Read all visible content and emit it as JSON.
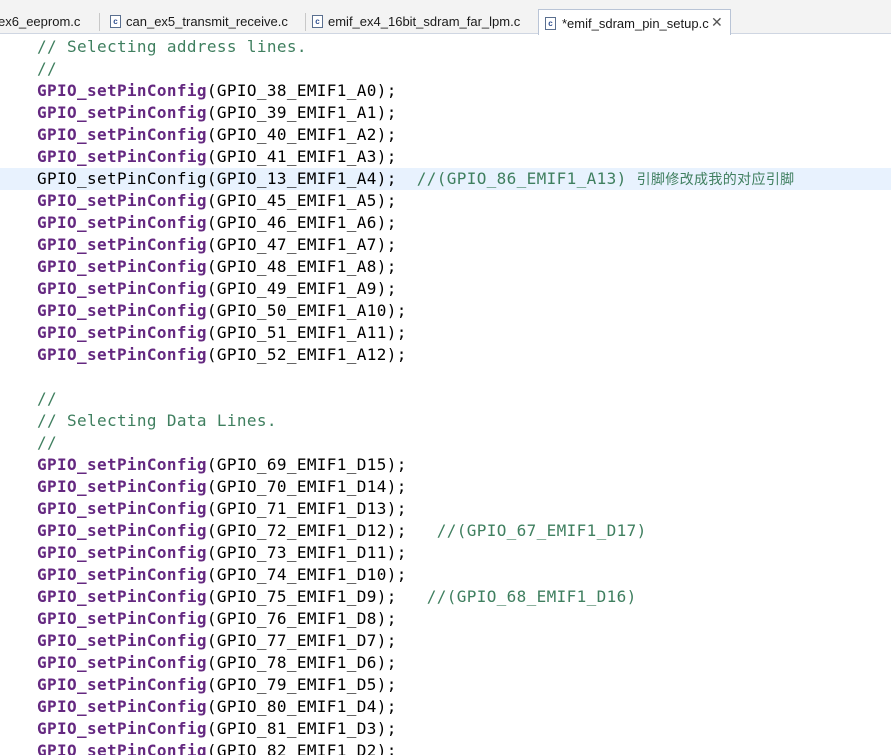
{
  "tabs": [
    {
      "label": "ex6_eeprom.c",
      "active": false,
      "icon": "c-file-icon"
    },
    {
      "label": "can_ex5_transmit_receive.c",
      "active": false,
      "icon": "c-file-icon"
    },
    {
      "label": "emif_ex4_16bit_sdram_far_lpm.c",
      "active": false,
      "icon": "c-file-icon"
    },
    {
      "label": "*emif_sdram_pin_setup.c",
      "active": true,
      "icon": "c-file-icon",
      "close": "✕"
    }
  ],
  "icon_glyph": "c",
  "highlighted_line": 6,
  "colors": {
    "function": "#642880",
    "comment": "#3f7f5f",
    "line_highlight": "#e8f2fe"
  },
  "code": [
    {
      "c": "// Selecting address lines."
    },
    {
      "c": "//"
    },
    {
      "f": "GPIO_setPinConfig",
      "a": "(GPIO_38_EMIF1_A0);"
    },
    {
      "f": "GPIO_setPinConfig",
      "a": "(GPIO_39_EMIF1_A1);"
    },
    {
      "f": "GPIO_setPinConfig",
      "a": "(GPIO_40_EMIF1_A2);"
    },
    {
      "f": "GPIO_setPinConfig",
      "a": "(GPIO_41_EMIF1_A3);"
    },
    {
      "p": "GPIO_setPinConfig(GPIO_13_EMIF1_A4);  ",
      "c": "//(GPIO_86_EMIF1_A13) ",
      "cn": "引脚修改成我的对应引脚"
    },
    {
      "f": "GPIO_setPinConfig",
      "a": "(GPIO_45_EMIF1_A5);"
    },
    {
      "f": "GPIO_setPinConfig",
      "a": "(GPIO_46_EMIF1_A6);"
    },
    {
      "f": "GPIO_setPinConfig",
      "a": "(GPIO_47_EMIF1_A7);"
    },
    {
      "f": "GPIO_setPinConfig",
      "a": "(GPIO_48_EMIF1_A8);"
    },
    {
      "f": "GPIO_setPinConfig",
      "a": "(GPIO_49_EMIF1_A9);"
    },
    {
      "f": "GPIO_setPinConfig",
      "a": "(GPIO_50_EMIF1_A10);"
    },
    {
      "f": "GPIO_setPinConfig",
      "a": "(GPIO_51_EMIF1_A11);"
    },
    {
      "f": "GPIO_setPinConfig",
      "a": "(GPIO_52_EMIF1_A12);"
    },
    {},
    {
      "c": "//"
    },
    {
      "c": "// Selecting Data Lines."
    },
    {
      "c": "//"
    },
    {
      "f": "GPIO_setPinConfig",
      "a": "(GPIO_69_EMIF1_D15);"
    },
    {
      "f": "GPIO_setPinConfig",
      "a": "(GPIO_70_EMIF1_D14);"
    },
    {
      "f": "GPIO_setPinConfig",
      "a": "(GPIO_71_EMIF1_D13);"
    },
    {
      "f": "GPIO_setPinConfig",
      "a": "(GPIO_72_EMIF1_D12);   ",
      "c": "//(GPIO_67_EMIF1_D17)"
    },
    {
      "f": "GPIO_setPinConfig",
      "a": "(GPIO_73_EMIF1_D11);"
    },
    {
      "f": "GPIO_setPinConfig",
      "a": "(GPIO_74_EMIF1_D10);"
    },
    {
      "f": "GPIO_setPinConfig",
      "a": "(GPIO_75_EMIF1_D9);   ",
      "c": "//(GPIO_68_EMIF1_D16)"
    },
    {
      "f": "GPIO_setPinConfig",
      "a": "(GPIO_76_EMIF1_D8);"
    },
    {
      "f": "GPIO_setPinConfig",
      "a": "(GPIO_77_EMIF1_D7);"
    },
    {
      "f": "GPIO_setPinConfig",
      "a": "(GPIO_78_EMIF1_D6);"
    },
    {
      "f": "GPIO_setPinConfig",
      "a": "(GPIO_79_EMIF1_D5);"
    },
    {
      "f": "GPIO_setPinConfig",
      "a": "(GPIO_80_EMIF1_D4);"
    },
    {
      "f": "GPIO_setPinConfig",
      "a": "(GPIO_81_EMIF1_D3);"
    },
    {
      "f": "GPIO_setPinConfig",
      "a": "(GPIO_82_EMIF1_D2);"
    }
  ]
}
